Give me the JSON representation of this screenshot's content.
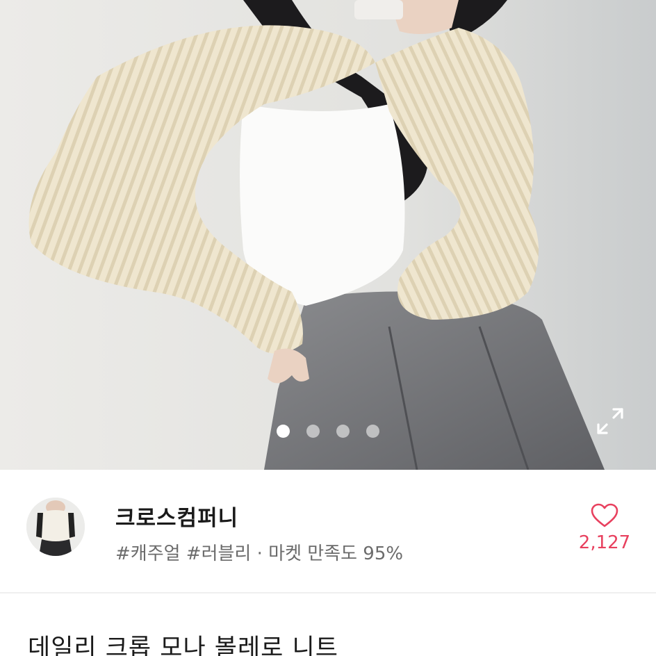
{
  "product": {
    "image_alt": "cream ribbed knit cropped bolero over white top and grey skirt",
    "carousel": {
      "count": 4,
      "active_index": 0
    },
    "title": "데일리 크롭 모나 볼레로 니트"
  },
  "seller": {
    "name": "크로스컴퍼니",
    "meta": "#캐주얼 #러블리 · 마켓 만족도 95%"
  },
  "like": {
    "count": "2,127",
    "color": "#e8405e"
  },
  "icons": {
    "expand": "expand-icon",
    "heart": "heart-outline-icon"
  }
}
